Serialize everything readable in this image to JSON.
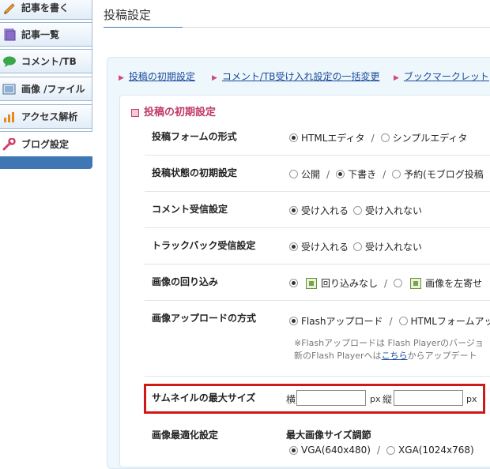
{
  "sidebar": {
    "items": [
      {
        "label": "記事を書く",
        "icon": "pencil-icon",
        "color": "#e8a23a"
      },
      {
        "label": "記事一覧",
        "icon": "document-icon",
        "color": "#8a6fc9"
      },
      {
        "label": "コメント/TB",
        "icon": "speech-bubble-icon",
        "color": "#3aa64a"
      },
      {
        "label": "画像 /ファイル",
        "icon": "image-file-icon",
        "color": "#6a8fb5"
      },
      {
        "label": "アクセス解析",
        "icon": "bar-chart-icon",
        "color": "#e88a1a"
      },
      {
        "label": "ブログ設定",
        "icon": "wrench-icon",
        "color": "#d0406a"
      }
    ]
  },
  "header": {
    "title": "投稿設定"
  },
  "tabs": [
    {
      "label": "投稿の初期設定"
    },
    {
      "label": "コメント/TB受け入れ設定の一括変更"
    },
    {
      "label": "ブックマークレット"
    }
  ],
  "section": {
    "title": "投稿の初期設定"
  },
  "rows": {
    "form_type": {
      "label": "投稿フォームの形式",
      "opt1": "HTMLエディタ",
      "opt2": "シンプルエディタ"
    },
    "post_state": {
      "label": "投稿状態の初期設定",
      "opt1": "公開",
      "opt2": "下書き",
      "opt3": "予約(モブログ投稿"
    },
    "comment": {
      "label": "コメント受信設定",
      "opt1": "受け入れる",
      "opt2": "受け入れない"
    },
    "trackback": {
      "label": "トラックバック受信設定",
      "opt1": "受け入れる",
      "opt2": "受け入れない"
    },
    "wrap": {
      "label": "画像の回り込み",
      "opt1": "回り込みなし",
      "opt2": "画像を左寄せ"
    },
    "upload": {
      "label": "画像アップロードの方式",
      "opt1": "Flashアップロード",
      "opt2": "HTMLフォームアップ",
      "note1": "※Flashアップロードは Flash Playerのバージョ",
      "note2_pre": "新のFlash Playerへは",
      "note2_link": "こちら",
      "note2_post": "からアップデート"
    },
    "thumbnail": {
      "label": "サムネイルの最大サイズ",
      "width_label": "横",
      "px1": "px",
      "height_label": "縦",
      "px2": "px",
      "width_value": "",
      "height_value": ""
    },
    "optimize": {
      "label": "画像最適化設定",
      "sub": "最大画像サイズ調節",
      "opt1": "VGA(640x480)",
      "opt2": "XGA(1024x768)"
    }
  },
  "colors": {
    "accent": "#3f76b4",
    "section": "#c03a6b",
    "highlight": "#d01818",
    "link": "#1a4a9c"
  }
}
